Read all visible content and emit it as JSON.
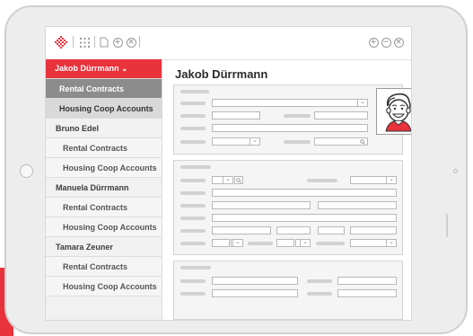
{
  "toolbar": {
    "logo_icon": "red-diamond-logo-icon",
    "icons": [
      "grid-icon",
      "document-icon",
      "plus-circle-icon",
      "close-circle-icon"
    ],
    "right_icons": [
      "plus-circle-icon",
      "minus-circle-icon",
      "close-circle-icon"
    ]
  },
  "sidebar": {
    "items": [
      {
        "label": "Jakob Dürrmann ⌄",
        "kind": "active"
      },
      {
        "label": "Rental Contracts",
        "kind": "dark"
      },
      {
        "label": "Housing Coop Accounts",
        "kind": "mid"
      },
      {
        "label": "Bruno Edel",
        "kind": "top"
      },
      {
        "label": "Rental Contracts",
        "kind": "sub"
      },
      {
        "label": "Housing Coop Accounts",
        "kind": "sub"
      },
      {
        "label": "Manuela Dürrmann",
        "kind": "top"
      },
      {
        "label": "Rental Contracts",
        "kind": "sub"
      },
      {
        "label": "Housing Coop Accounts",
        "kind": "sub"
      },
      {
        "label": "Tamara Zeuner",
        "kind": "top"
      },
      {
        "label": "Rental Contracts",
        "kind": "sub"
      },
      {
        "label": "Housing Coop Accounts",
        "kind": "sub"
      }
    ]
  },
  "main": {
    "title": "Jakob Dürrmann"
  },
  "colors": {
    "accent": "#e8323c",
    "sidebar_selected": "#8c8c8c"
  }
}
